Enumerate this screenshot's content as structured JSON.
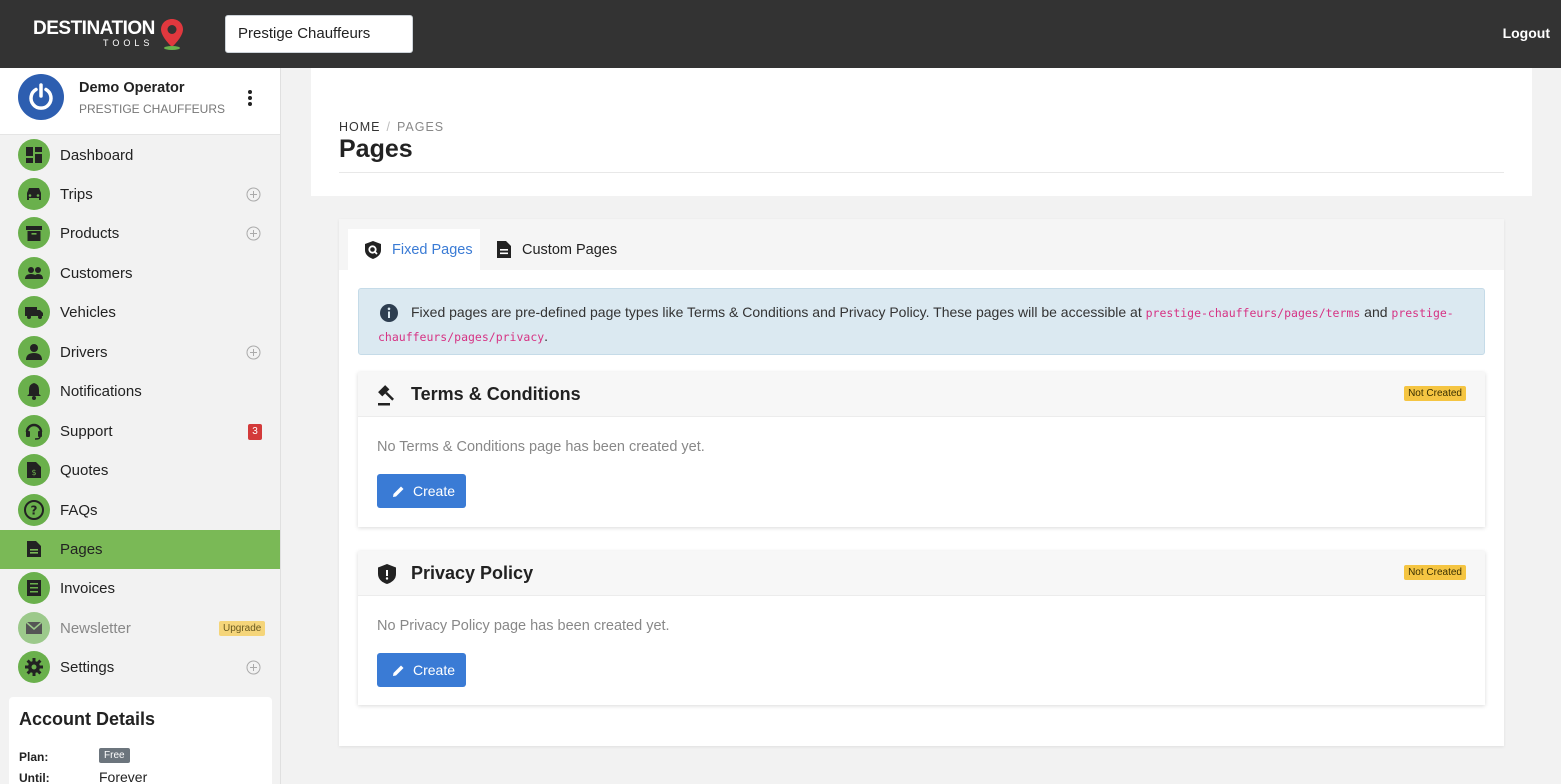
{
  "brand": {
    "line1": "DESTINATION",
    "line2": "TOOLS"
  },
  "operator_select": {
    "value": "Prestige Chauffeurs"
  },
  "logout_label": "Logout",
  "profile": {
    "name": "Demo Operator",
    "company": "PRESTIGE CHAUFFEURS"
  },
  "sidebar": {
    "items": [
      {
        "label": "Dashboard",
        "icon": "dashboard-icon",
        "plus": false
      },
      {
        "label": "Trips",
        "icon": "car-icon",
        "plus": true
      },
      {
        "label": "Products",
        "icon": "archive-icon",
        "plus": true
      },
      {
        "label": "Customers",
        "icon": "people-icon",
        "plus": false
      },
      {
        "label": "Vehicles",
        "icon": "truck-icon",
        "plus": false
      },
      {
        "label": "Drivers",
        "icon": "person-icon",
        "plus": true
      },
      {
        "label": "Notifications",
        "icon": "bell-icon",
        "plus": false
      },
      {
        "label": "Support",
        "icon": "headset-icon",
        "badge": "3"
      },
      {
        "label": "Quotes",
        "icon": "invoice-dollar-icon",
        "plus": false
      },
      {
        "label": "FAQs",
        "icon": "question-icon",
        "plus": false
      },
      {
        "label": "Pages",
        "icon": "document-icon",
        "active": true
      },
      {
        "label": "Invoices",
        "icon": "receipt-icon",
        "plus": false
      },
      {
        "label": "Newsletter",
        "icon": "mail-icon",
        "badge_upgrade": "Upgrade",
        "disabled": true
      },
      {
        "label": "Settings",
        "icon": "gear-icon",
        "plus": true
      }
    ]
  },
  "account": {
    "title": "Account Details",
    "plan_label": "Plan:",
    "plan_value": "Free",
    "until_label": "Until:",
    "until_value": "Forever"
  },
  "breadcrumb": {
    "home": "HOME",
    "current": "PAGES"
  },
  "page_title": "Pages",
  "tabs": [
    {
      "label": "Fixed Pages",
      "active": true
    },
    {
      "label": "Custom Pages",
      "active": false
    }
  ],
  "info": {
    "text_before": "Fixed pages are pre-defined page types like Terms & Conditions and Privacy Policy. These pages will be accessible at ",
    "code1": "prestige-chauffeurs/pages/terms",
    "and": " and ",
    "code2": "prestige-chauffeurs/pages/privacy",
    "end": "."
  },
  "cards": [
    {
      "title": "Terms & Conditions",
      "status": "Not Created",
      "message": "No Terms & Conditions page has been created yet.",
      "button": "Create"
    },
    {
      "title": "Privacy Policy",
      "status": "Not Created",
      "message": "No Privacy Policy page has been created yet.",
      "button": "Create"
    }
  ],
  "colors": {
    "topbar": "#333333",
    "accent_green": "#6ab04c",
    "active_green": "#7ab956",
    "primary_blue": "#3a7bd5",
    "warning_yellow": "#f5c542"
  }
}
